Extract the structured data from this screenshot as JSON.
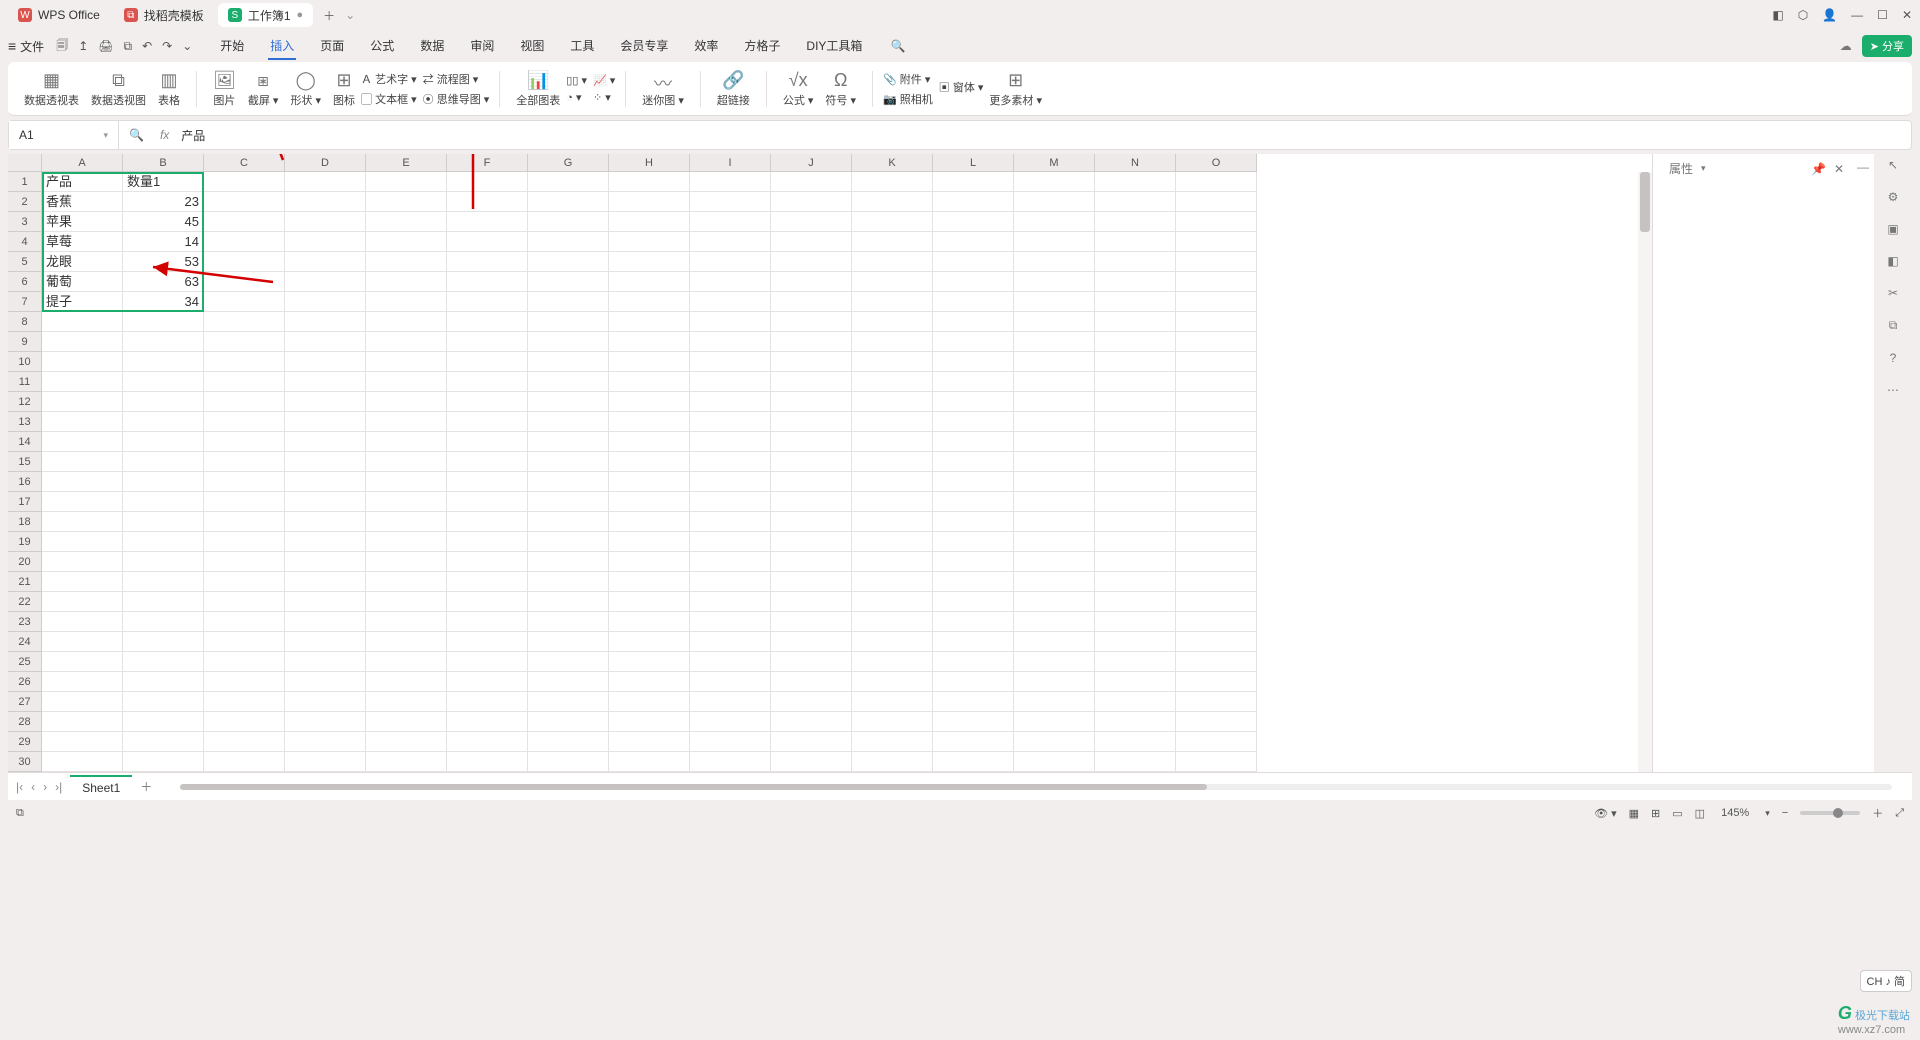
{
  "titlebar": {
    "tabs": [
      {
        "icon": "W",
        "label": "WPS Office",
        "active": false,
        "iconColor": "red"
      },
      {
        "icon": "⧉",
        "label": "找稻壳模板",
        "active": false,
        "iconColor": "red"
      },
      {
        "icon": "S",
        "label": "工作簿1",
        "active": true,
        "iconColor": "green",
        "closable": true
      }
    ]
  },
  "menubar": {
    "file": "文件",
    "tabs": [
      "开始",
      "插入",
      "页面",
      "公式",
      "数据",
      "审阅",
      "视图",
      "工具",
      "会员专享",
      "效率",
      "方格子",
      "DIY工具箱"
    ],
    "active_index": 1,
    "share": "分享"
  },
  "ribbon": {
    "pivotTable": "数据透视表",
    "pivotChart": "数据透视图",
    "table": "表格",
    "picture": "图片",
    "screenshot": "截屏",
    "shapes": "形状",
    "icons": "图标",
    "wordart": "艺术字",
    "textbox": "文本框",
    "flowchart": "流程图",
    "mindmap": "思维导图",
    "allcharts": "全部图表",
    "sparkline": "迷你图",
    "hyperlink": "超链接",
    "formula": "公式",
    "symbol": "符号",
    "attachment": "附件",
    "slicer": "窗体",
    "camera": "照相机",
    "more": "更多素材"
  },
  "cellref": "A1",
  "formula_value": "产品",
  "columns": [
    "A",
    "B",
    "C",
    "D",
    "E",
    "F",
    "G",
    "H",
    "I",
    "J",
    "K",
    "L",
    "M",
    "N",
    "O"
  ],
  "row_count": 30,
  "data": {
    "headers": [
      "产品",
      "数量1"
    ],
    "rows": [
      [
        "香蕉",
        23
      ],
      [
        "苹果",
        45
      ],
      [
        "草莓",
        14
      ],
      [
        "龙眼",
        53
      ],
      [
        "葡萄",
        63
      ],
      [
        "提子",
        34
      ]
    ]
  },
  "chart_data": {
    "type": "table",
    "categories": [
      "香蕉",
      "苹果",
      "草莓",
      "龙眼",
      "葡萄",
      "提子"
    ],
    "series": [
      {
        "name": "数量1",
        "values": [
          23,
          45,
          14,
          53,
          63,
          34
        ]
      }
    ],
    "title": "",
    "xlabel": "产品",
    "ylabel": "数量1"
  },
  "taskpane": {
    "title": "属性"
  },
  "sheet": {
    "name": "Sheet1"
  },
  "status": {
    "ime": "CH ♪ 简",
    "zoom": "145%"
  },
  "watermark": {
    "brand": "极光下载站",
    "url": "www.xz7.com"
  }
}
